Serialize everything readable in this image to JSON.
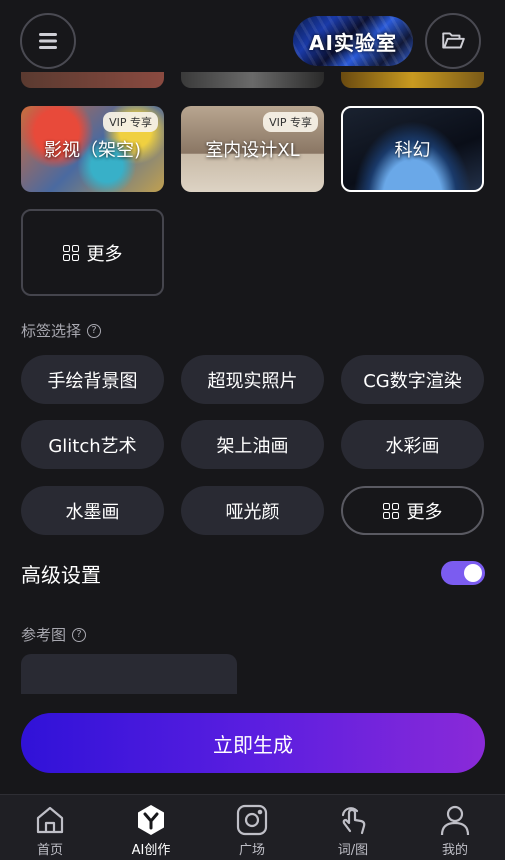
{
  "header": {
    "menu_icon": "hamburger-menu-icon",
    "lab_badge": "AI实验室",
    "folder_icon": "folder-open-icon"
  },
  "styles": {
    "cards": [
      {
        "label": "影视（架空)",
        "vip": "VIP 专享"
      },
      {
        "label": "室内设计XL",
        "vip": "VIP 专享"
      },
      {
        "label": "科幻",
        "vip": ""
      }
    ],
    "more_label": "更多"
  },
  "tags": {
    "section_label": "标签选择",
    "items": [
      "手绘背景图",
      "超现实照片",
      "CG数字渲染",
      "Glitch艺术",
      "架上油画",
      "水彩画",
      "水墨画",
      "哑光颜"
    ],
    "more_label": "更多"
  },
  "advanced": {
    "label": "高级设置",
    "toggle_on": true
  },
  "reference": {
    "label": "参考图"
  },
  "generate_label": "立即生成",
  "nav": {
    "items": [
      {
        "label": "首页",
        "icon": "home-icon"
      },
      {
        "label": "AI创作",
        "icon": "ai-create-icon"
      },
      {
        "label": "广场",
        "icon": "plaza-icon"
      },
      {
        "label": "词/图",
        "icon": "touch-icon"
      },
      {
        "label": "我的",
        "icon": "profile-icon"
      }
    ],
    "active": "AI创作"
  },
  "colors": {
    "accent": "#7b5cf0",
    "gradient_start": "#3012d8",
    "gradient_end": "#8a2ad8"
  }
}
